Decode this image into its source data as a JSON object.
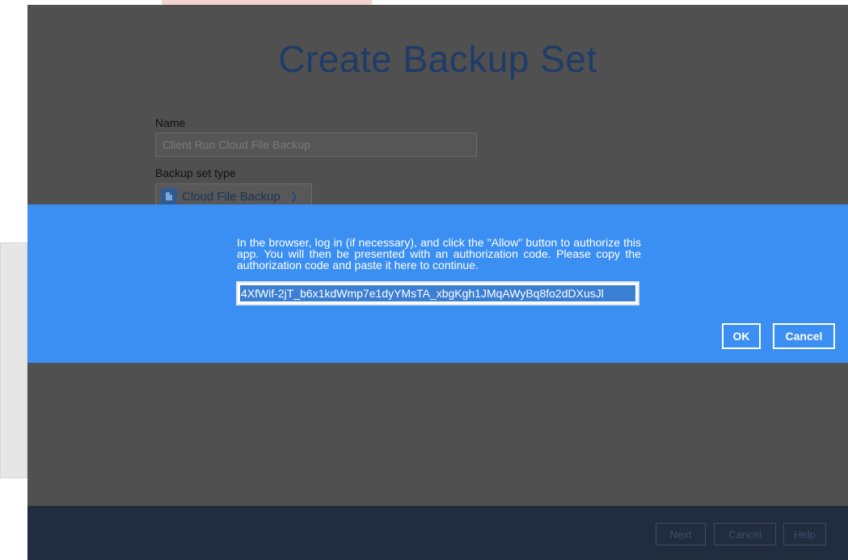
{
  "page": {
    "title": "Create Backup Set"
  },
  "form": {
    "name_label": "Name",
    "name_value": "Client Run Cloud File Backup",
    "type_label": "Backup set type",
    "type_value": "Cloud File Backup"
  },
  "dialog": {
    "message": "In the browser, log in (if necessary), and click the \"Allow\" button to authorize this app. You will then be presented with an authorization code. Please copy the authorization code and paste it here to continue.",
    "auth_code": "4XfWif-2jT_b6x1kdWmp7e1dyYMsTA_xbgKgh1JMqAWyBq8fo2dDXusJl",
    "ok_label": "OK",
    "cancel_label": "Cancel"
  },
  "footer": {
    "next_label": "Next",
    "cancel_label": "Cancel",
    "help_label": "Help"
  },
  "colors": {
    "dialog_bg": "#3b8ff2",
    "title_color": "#1f3c68",
    "footer_bg": "#212c3e"
  }
}
